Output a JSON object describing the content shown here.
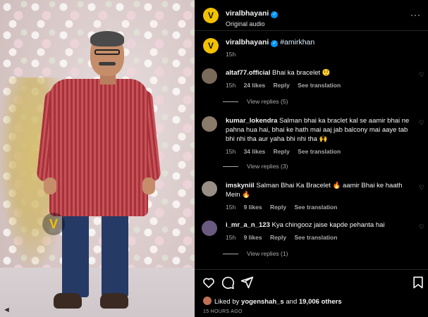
{
  "colors": {
    "bg": "#000000",
    "text": "#f5f5f5",
    "muted": "#a8a8a8",
    "verified": "#0095f6",
    "avatar": "#f2c200"
  },
  "header": {
    "avatar_letter": "V",
    "username": "viralbhayani",
    "audio": "Original audio",
    "more_icon": "more-dots-icon"
  },
  "caption": {
    "avatar_letter": "V",
    "username": "viralbhayani",
    "text": "#amirkhan",
    "time": "15h"
  },
  "comments": [
    {
      "username": "altaf77.official",
      "text": "Bhai ka bracelet 🤨",
      "time": "15h",
      "likes": "24 likes",
      "reply": "Reply",
      "translate": "See translation",
      "view_replies": "View replies (5)",
      "avatar_color": "#7a6a5a"
    },
    {
      "username": "kumar_lokendra",
      "text": "Salman bhai ka braclet kal se aamir bhai ne pahna hua hai, bhai ke hath mai aaj jab balcony mai aaye tab bhi nhi tha aur yaha bhi nhi tha 🙌",
      "time": "15h",
      "likes": "34 likes",
      "reply": "Reply",
      "translate": "See translation",
      "view_replies": "View replies (3)",
      "avatar_color": "#8a7a6a"
    },
    {
      "username": "imskyniil",
      "text": "Salman Bhai Ka Bracelet 🔥 aamir Bhai ke haath Mein 🔥",
      "time": "15h",
      "likes": "9 likes",
      "reply": "Reply",
      "translate": "See translation",
      "view_replies": "",
      "avatar_color": "#9a8f86"
    },
    {
      "username": "i_mr_a_n_123",
      "text": "Kya chingooz jaise kapde pehanta hai",
      "time": "15h",
      "likes": "9 likes",
      "reply": "Reply",
      "translate": "See translation",
      "view_replies": "View replies (1)",
      "avatar_color": "#6a5a80"
    }
  ],
  "actions": {
    "like_icon": "heart-icon",
    "comment_icon": "comment-icon",
    "share_icon": "share-icon",
    "save_icon": "bookmark-icon"
  },
  "likes": {
    "prefix": "Liked by",
    "user": "yogenshah_s",
    "joiner": "and",
    "others": "19,006 others"
  },
  "posted": "15 HOURS AGO",
  "media": {
    "watermark_letter": "V"
  }
}
